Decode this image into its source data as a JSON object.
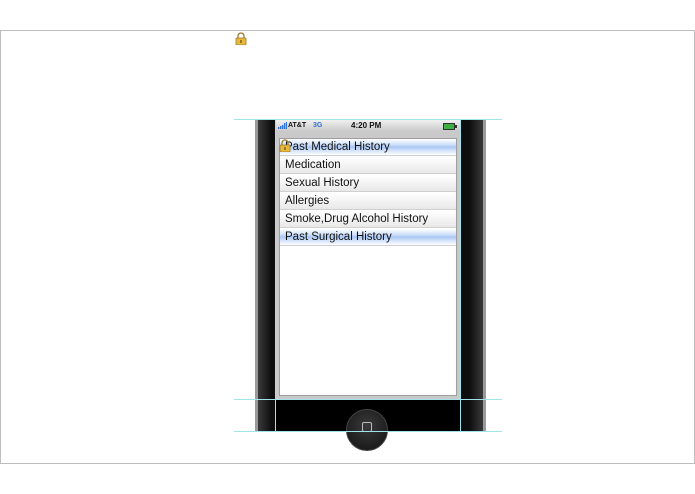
{
  "statusbar": {
    "carrier": "AT&T",
    "network": "3G",
    "time": "4:20 PM",
    "battery_color": "#3cb043"
  },
  "menu": {
    "items": [
      {
        "label": "Past Medical History",
        "selected": true
      },
      {
        "label": "Medication",
        "selected": false
      },
      {
        "label": "Sexual History",
        "selected": false
      },
      {
        "label": "Allergies",
        "selected": false
      },
      {
        "label": "Smoke,Drug Alcohol History",
        "selected": false
      },
      {
        "label": "Past Surgical History",
        "selected": true
      }
    ]
  },
  "icons": {
    "lock": "lock-icon",
    "signal": "signal-bars-icon",
    "battery": "battery-icon",
    "home": "home-button-icon"
  },
  "colors": {
    "selection": "#a9c6f3",
    "guide": "#9ee3ee",
    "network": "#2f6fd8"
  }
}
